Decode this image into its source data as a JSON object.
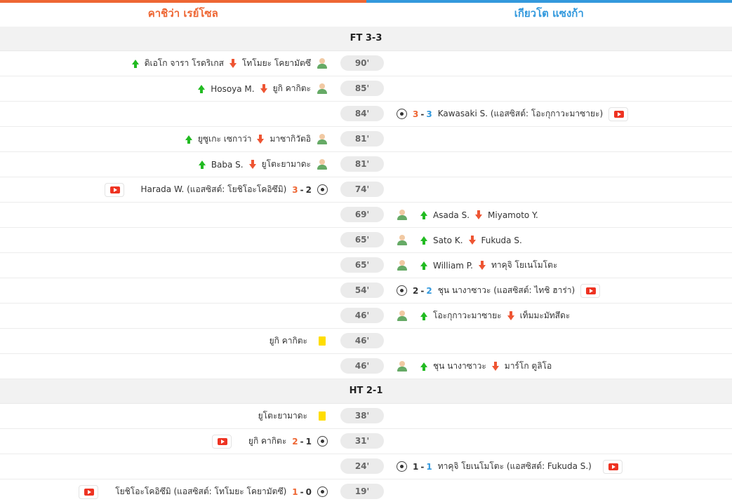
{
  "teams": {
    "home": "คาชิว่า เรย์โซล",
    "away": "เกียวโต แซงก้า"
  },
  "periods": {
    "ft": "FT 3-3",
    "ht": "HT 2-1"
  },
  "events": [
    {
      "minute": "90'",
      "home": {
        "in": "ดิเอโก จารา โรดริเกส",
        "out": "โทโมยะ โคยามัตซึ"
      }
    },
    {
      "minute": "85'",
      "home": {
        "in": "Hosoya M.",
        "out": "ยูกิ คากิตะ"
      }
    },
    {
      "minute": "84'",
      "away": {
        "score_home": "3",
        "score_away": "3",
        "text": "Kawasaki S. (แอสซิสต์: โอะกุกาวะมาซายะ)"
      }
    },
    {
      "minute": "81'",
      "home": {
        "in": "ยูซูเกะ เซกาว่า",
        "out": "มาซากิวัตอิ"
      }
    },
    {
      "minute": "81'",
      "home": {
        "in": "Baba S.",
        "out": "ยูโตะยามาดะ"
      }
    },
    {
      "minute": "74'",
      "home": {
        "score_home": "3",
        "score_away": "2",
        "text": "Harada W. (แอสซิสต์: โยชิโอะโคอิซึมิ)"
      }
    },
    {
      "minute": "69'",
      "away": {
        "in": "Asada S.",
        "out": "Miyamoto Y."
      }
    },
    {
      "minute": "65'",
      "away": {
        "in": "Sato K.",
        "out": "Fukuda S."
      }
    },
    {
      "minute": "65'",
      "away": {
        "in": "William P.",
        "out": "ทาคุจิ โยเนโมโตะ"
      }
    },
    {
      "minute": "54'",
      "away": {
        "score_home": "2",
        "score_away": "2",
        "text": "ชุน นางาซาวะ (แอสซิสต์: ไทชิ ฮาร่า)"
      }
    },
    {
      "minute": "46'",
      "away": {
        "in": "โอะกุกาวะมาซายะ",
        "out": "เท็มมะมัทสึดะ"
      }
    },
    {
      "minute": "46'",
      "home": {
        "card": "ยูกิ คากิตะ"
      }
    },
    {
      "minute": "46'",
      "away": {
        "in": "ชุน นางาซาวะ",
        "out": "มาร์โก ตูลิโอ"
      }
    },
    {
      "minute": "38'",
      "home": {
        "card": "ยูโตะยามาดะ"
      }
    },
    {
      "minute": "31'",
      "home": {
        "score_home": "2",
        "score_away": "1",
        "text": "ยูกิ คากิตะ"
      }
    },
    {
      "minute": "24'",
      "away": {
        "score_home": "1",
        "score_away": "1",
        "text": "ทาคุจิ โยเนโมโตะ (แอสซิสต์: Fukuda S.)"
      }
    },
    {
      "minute": "19'",
      "home": {
        "score_home": "1",
        "score_away": "0",
        "text": "โยชิโอะโคอิซึมิ (แอสซิสต์: โทโมยะ โคยามัตซึ)"
      }
    }
  ],
  "icons": {
    "substitution_in": "arrow-up-icon",
    "substitution_out": "arrow-down-icon",
    "player": "player-icon",
    "goal": "football-icon",
    "yellow_card": "yellow-card-icon",
    "video": "video-icon"
  },
  "colors": {
    "home": "#ee6633",
    "away": "#3399dd",
    "in": "#22bb22",
    "out": "#ee5533",
    "card": "#ffdd00",
    "video": "#ee3322"
  }
}
